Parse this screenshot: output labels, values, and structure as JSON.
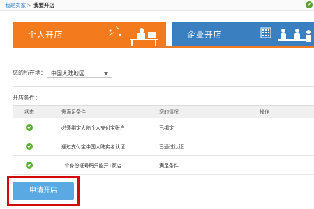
{
  "breadcrumb": {
    "link": "我是卖家",
    "separator": ">",
    "current": "我要开店"
  },
  "help_icon": "question-icon",
  "tabs": [
    {
      "label": "个人开店",
      "active": true,
      "color": "#f37b1d"
    },
    {
      "label": "企业开店",
      "active": false,
      "color": "#3a7fc0"
    }
  ],
  "location": {
    "label": "您的所在地：",
    "selected": "中国大陆地区"
  },
  "conditions": {
    "label": "开店条件：",
    "headers": [
      "状态",
      "需满足条件",
      "您的情况",
      "操作"
    ],
    "rows": [
      {
        "status_icon": "check-icon",
        "condition": "必须绑定大陆个人支付宝账户",
        "situation": "已绑定",
        "action": ""
      },
      {
        "status_icon": "check-icon",
        "condition": "通过支付宝中国大陆实名认证",
        "situation": "已通过认证",
        "action": ""
      },
      {
        "status_icon": "check-icon",
        "condition": "1个身份证号码只能开1家店",
        "situation": "满足条件",
        "action": ""
      }
    ]
  },
  "apply_button": {
    "label": "申请开店",
    "color": "#5ba9e3",
    "highlight_color": "#d20a0a"
  }
}
